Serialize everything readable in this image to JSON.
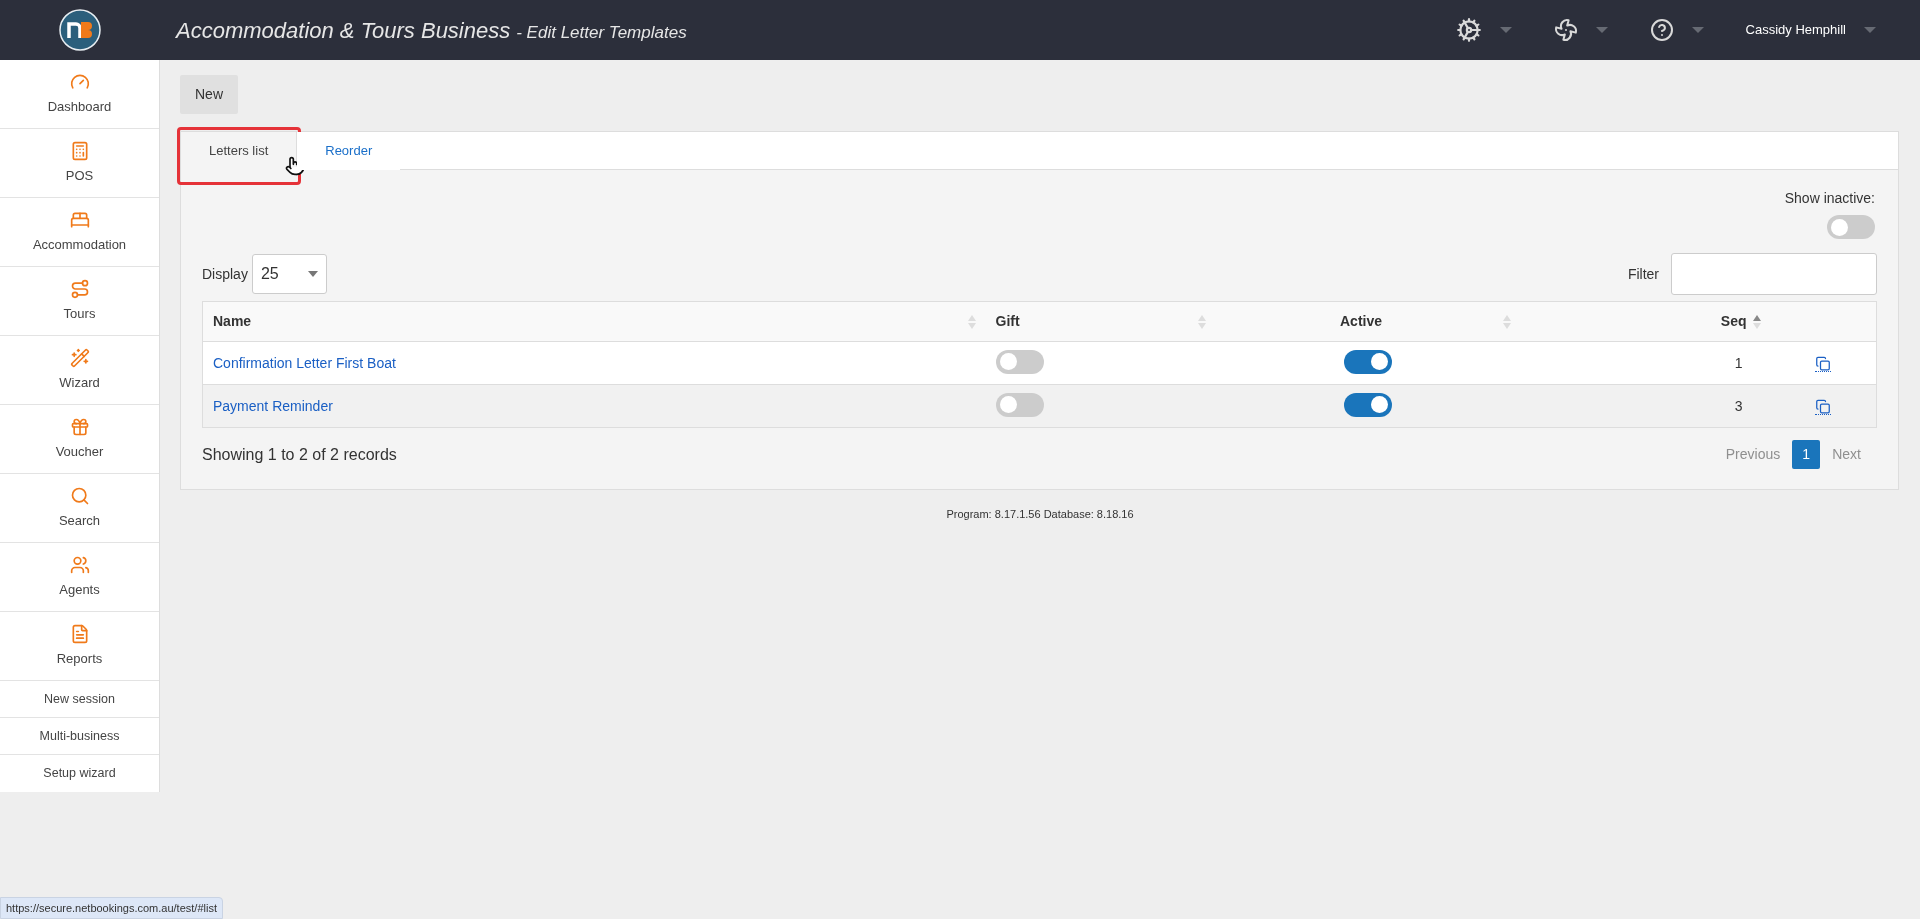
{
  "header": {
    "title": "Accommodation & Tours Business",
    "subtitle": "- Edit Letter Templates",
    "user": "Cassidy Hemphill"
  },
  "sidebar": {
    "items": [
      {
        "label": "Dashboard"
      },
      {
        "label": "POS"
      },
      {
        "label": "Accommodation"
      },
      {
        "label": "Tours"
      },
      {
        "label": "Wizard"
      },
      {
        "label": "Voucher"
      },
      {
        "label": "Search"
      },
      {
        "label": "Agents"
      },
      {
        "label": "Reports"
      }
    ],
    "links": [
      {
        "label": "New session"
      },
      {
        "label": "Multi-business"
      },
      {
        "label": "Setup wizard"
      }
    ]
  },
  "new_button": "New",
  "tabs": [
    {
      "label": "Letters list",
      "selected": true,
      "highlighted": true
    },
    {
      "label": "Reorder",
      "selected": false,
      "highlighted": false
    }
  ],
  "show_inactive": {
    "label": "Show inactive:",
    "on": false
  },
  "display": {
    "label": "Display",
    "value": "25"
  },
  "filter": {
    "label": "Filter"
  },
  "table": {
    "columns": [
      {
        "label": "Name",
        "sorted": false
      },
      {
        "label": "Gift",
        "sorted": false
      },
      {
        "label": "Active",
        "sorted": false
      },
      {
        "label": "Seq",
        "sorted": true
      }
    ],
    "rows": [
      {
        "name": "Confirmation Letter First Boat",
        "gift": false,
        "active": true,
        "seq": "1"
      },
      {
        "name": "Payment Reminder",
        "gift": false,
        "active": true,
        "seq": "3"
      }
    ]
  },
  "summary": "Showing 1 to 2 of 2 records",
  "pagination": {
    "previous": "Previous",
    "pages": [
      {
        "label": "1",
        "selected": true
      }
    ],
    "next": "Next"
  },
  "footer": "Program: 8.17.1.56 Database: 8.18.16",
  "status_url": "https://secure.netbookings.com.au/test/#list"
}
